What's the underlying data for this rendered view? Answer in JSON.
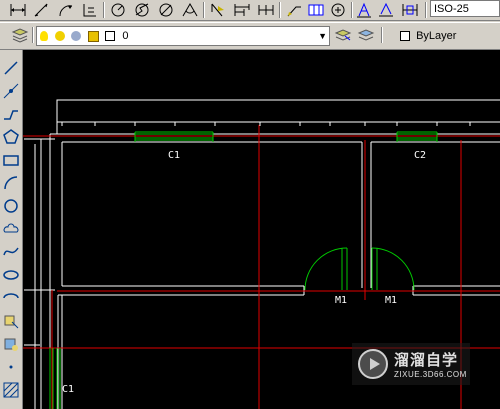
{
  "toolbar": {
    "dim_style": "ISO-25",
    "layer_name": "0",
    "color_value": "ByLayer",
    "icons": [
      "dim-linear-icon",
      "dim-aligned-icon",
      "dim-arc-icon",
      "dim-ordinate-icon",
      "dim-radius-icon",
      "dim-jogged-icon",
      "dim-diameter-icon",
      "dim-angular-icon",
      "quick-dim-icon",
      "dim-baseline-icon",
      "dim-continue-icon",
      "quick-leader-icon",
      "tolerance-icon",
      "center-mark-icon",
      "dim-edit-icon",
      "dim-text-edit-icon",
      "dim-update-icon"
    ],
    "layer_icons": [
      "layer-manager-icon",
      "lightbulb-icon",
      "sun-icon",
      "layer-lock-icon",
      "layer-color-icon"
    ]
  },
  "drawtools": [
    "line-icon",
    "construction-line-icon",
    "polyline-icon",
    "polygon-icon",
    "rectangle-icon",
    "arc-icon",
    "circle-icon",
    "revision-cloud-icon",
    "spline-icon",
    "ellipse-icon",
    "ellipse-arc-icon",
    "insert-block-icon",
    "make-block-icon",
    "point-icon",
    "hatch-icon"
  ],
  "drawing": {
    "labels": {
      "window1": "C1",
      "window2": "C2",
      "door1": "M1",
      "door2": "M1",
      "window3": "C1"
    }
  },
  "watermark": {
    "brand": "溜溜自学",
    "url": "ZIXUE.3D66.COM"
  }
}
